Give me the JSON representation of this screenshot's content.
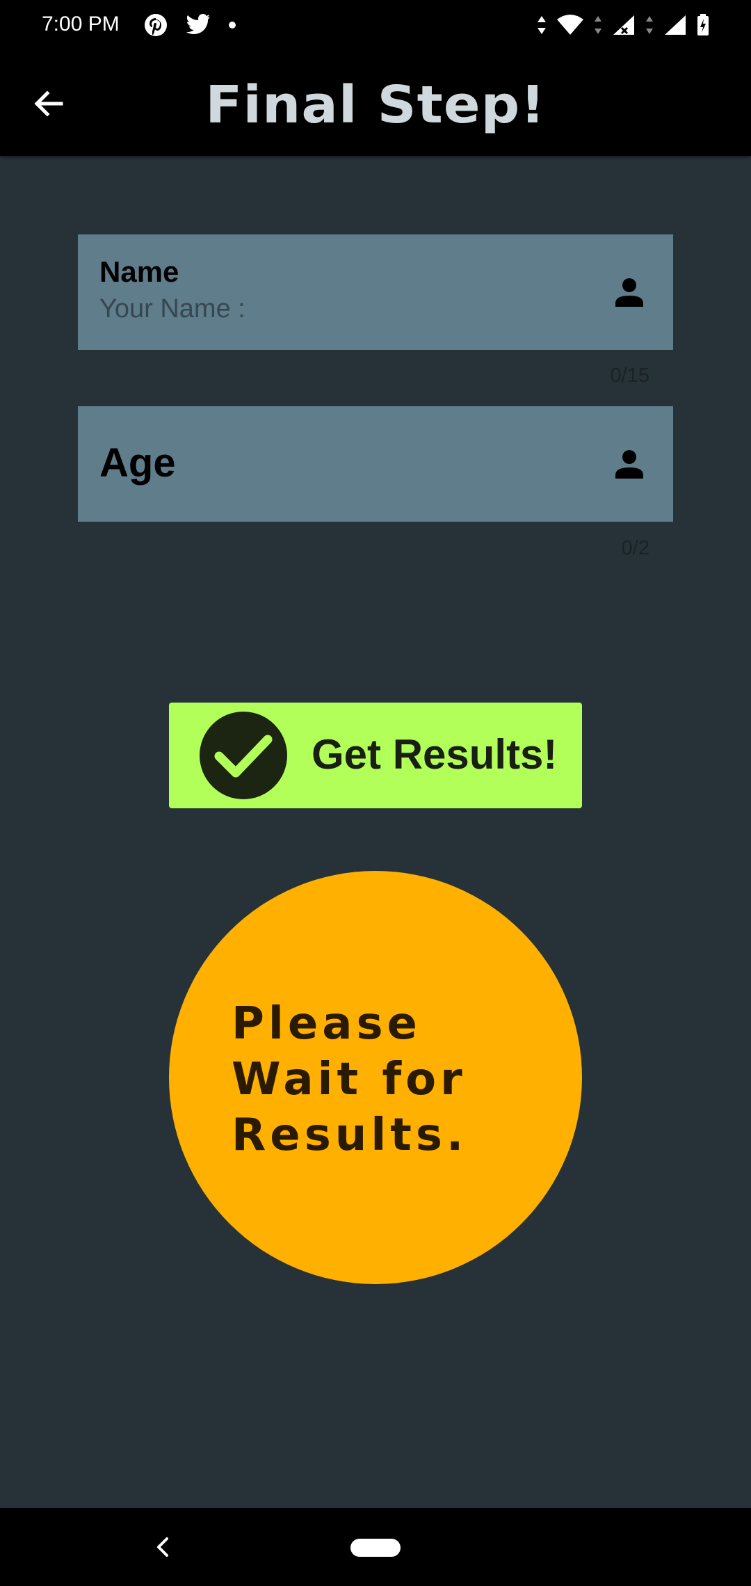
{
  "status_bar": {
    "time": "7:00 PM",
    "left_icons": [
      "pinterest-icon",
      "twitter-icon",
      "dot-icon"
    ],
    "right_icons": [
      "data-arrows-icon",
      "wifi-icon",
      "signal-no-sim-icon",
      "signal-icon",
      "battery-charging-icon"
    ]
  },
  "app_bar": {
    "title": "Final Step!",
    "back_icon": "arrow-back-icon"
  },
  "form": {
    "name_field": {
      "label": "Name",
      "placeholder": "Your Name :",
      "counter": "0/15",
      "icon": "person-icon"
    },
    "age_field": {
      "label": "Age",
      "counter": "0/2",
      "icon": "person-icon"
    }
  },
  "get_results_button": {
    "label": "Get Results!",
    "icon": "check-circle-icon"
  },
  "wait_indicator": {
    "text_line1": "Please",
    "text_line2": "Wait for",
    "text_line3": "Results."
  },
  "nav_bar": {
    "back_icon": "nav-back-icon",
    "home_icon": "home-pill-icon"
  },
  "colors": {
    "background": "#263238",
    "field_background": "#607d8b",
    "button_green": "#b2ff59",
    "wait_orange": "#ffb000",
    "title_color": "#cfd8dc"
  }
}
